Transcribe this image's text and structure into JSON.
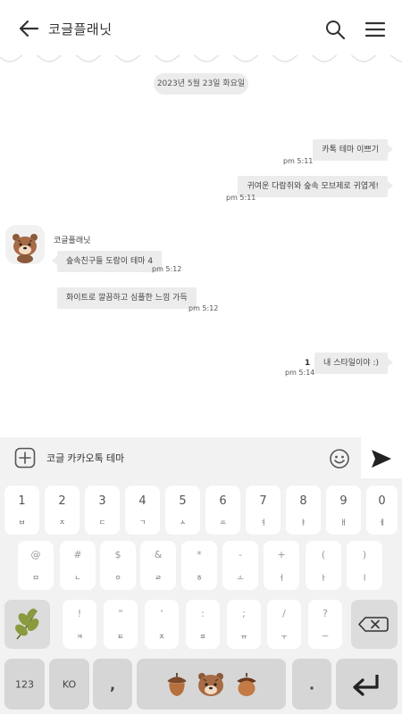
{
  "header": {
    "title": "코글플래닛"
  },
  "date": "2023년 5월 23일 화요일",
  "messages": [
    {
      "text": "카톡 테마 이쁘기",
      "time": "pm 5:11"
    },
    {
      "text": "귀여운 다람쥐와 숲속 모브제로 귀엽게!",
      "time": "pm 5:11"
    },
    {
      "text": "숲속친구들 도람이 테마 4",
      "time": "pm 5:12"
    },
    {
      "text": "화이트로 깔끔하고 심플한 느낌 가득",
      "time": "pm 5:12"
    },
    {
      "text": "내 스타일이야 :)",
      "time": "pm 5:14",
      "unread": "1"
    }
  ],
  "sender": "코글플래닛",
  "input": {
    "value": "코글 카카오톡 테마"
  },
  "keyboard": {
    "row1": [
      {
        "top": "1",
        "bot": "ㅂ"
      },
      {
        "top": "2",
        "bot": "ㅈ"
      },
      {
        "top": "3",
        "bot": "ㄷ"
      },
      {
        "top": "4",
        "bot": "ㄱ"
      },
      {
        "top": "5",
        "bot": "ㅅ"
      },
      {
        "top": "6",
        "bot": "ㅛ"
      },
      {
        "top": "7",
        "bot": "ㅕ"
      },
      {
        "top": "8",
        "bot": "ㅑ"
      },
      {
        "top": "9",
        "bot": "ㅐ"
      },
      {
        "top": "0",
        "bot": "ㅔ"
      }
    ],
    "row2": [
      {
        "top": "@",
        "bot": "ㅁ"
      },
      {
        "top": "#",
        "bot": "ㄴ"
      },
      {
        "top": "$",
        "bot": "ㅇ"
      },
      {
        "top": "&",
        "bot": "ㄹ"
      },
      {
        "top": "*",
        "bot": "ㅎ"
      },
      {
        "top": "-",
        "bot": "ㅗ"
      },
      {
        "top": "+",
        "bot": "ㅓ"
      },
      {
        "top": "(",
        "bot": "ㅏ"
      },
      {
        "top": ")",
        "bot": "ㅣ"
      }
    ],
    "row3": [
      {
        "top": "!",
        "bot": "ㅋ"
      },
      {
        "top": "\"",
        "bot": "ㅌ"
      },
      {
        "top": "'",
        "bot": "ㅊ"
      },
      {
        "top": ":",
        "bot": "ㅍ"
      },
      {
        "top": ";",
        "bot": "ㅠ"
      },
      {
        "top": "/",
        "bot": "ㅜ"
      },
      {
        "top": "?",
        "bot": "ㅡ"
      }
    ],
    "bottom": {
      "num": "123",
      "lang": "KO",
      "comma": ",",
      "period": "."
    }
  },
  "icons": [
    "back-arrow-icon",
    "search-icon",
    "menu-icon",
    "plus-icon",
    "emoji-icon",
    "send-icon",
    "leaf-icon",
    "backspace-icon",
    "enter-icon"
  ],
  "colors": {
    "bubble": "#ececec",
    "keyboard_bg": "#f2f2f2",
    "brown": "#8a5a3a"
  }
}
